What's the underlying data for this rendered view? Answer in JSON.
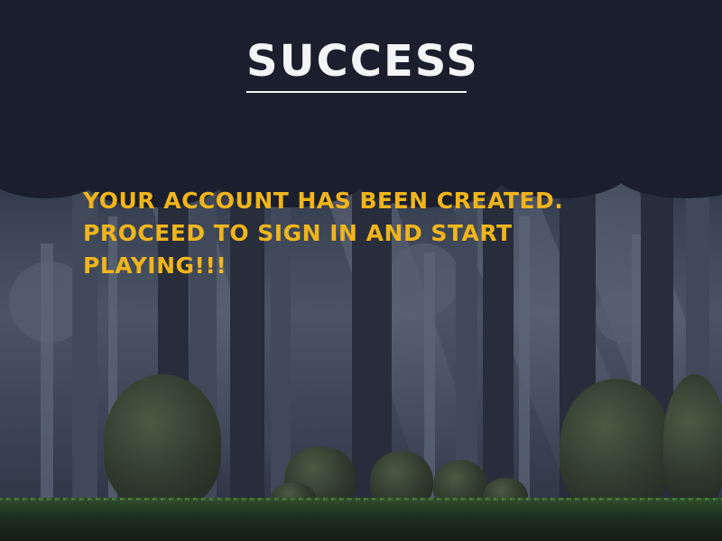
{
  "screen": {
    "title": "SUCCESS",
    "message": "YOUR ACCOUNT HAS BEEN CREATED. PROCEED TO SIGN IN AND START PLAYING!!!"
  },
  "colors": {
    "title": "#f2f4f5",
    "message": "#f0b51c",
    "canopy": "#1b1f2d"
  },
  "background": {
    "scene": "pixel-art dark forest"
  }
}
